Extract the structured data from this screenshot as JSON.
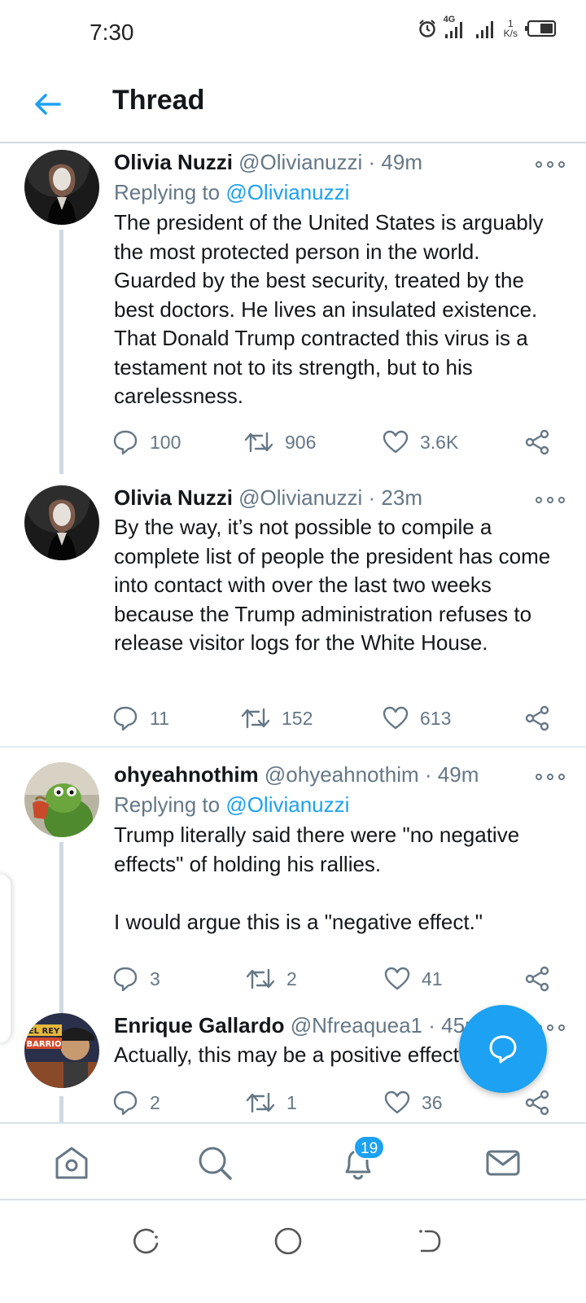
{
  "status_bar": {
    "time": "7:30",
    "network_type": "4G",
    "speed_value": "1",
    "speed_unit": "K/s"
  },
  "header": {
    "title": "Thread",
    "back_icon": "arrow-left-icon"
  },
  "tweets": [
    {
      "name": "Olivia Nuzzi",
      "handle": "@Olivianuzzi",
      "dot": "·",
      "time": "49m",
      "replying_label": "Replying to",
      "replying_to": "@Olivianuzzi",
      "text": "The president of the United States is arguably the most protected person in the world. Guarded by the best security, treated by the best doctors. He lives an insulated existence. That Donald Trump contracted this virus is a testament not to its strength, but to his carelessness.",
      "replies": "100",
      "retweets": "906",
      "likes": "3.6K"
    },
    {
      "name": "Olivia Nuzzi",
      "handle": "@Olivianuzzi",
      "dot": "·",
      "time": "23m",
      "text": "By the way, it’s not possible to compile a complete list of people the president has come into contact with over the last two weeks because the Trump administration refuses to release visitor logs for the White House.",
      "replies": "11",
      "retweets": "152",
      "likes": "613"
    },
    {
      "name": "ohyeahnothim",
      "handle": "@ohyeahnothim",
      "dot": "·",
      "time": "49m",
      "replying_label": "Replying to",
      "replying_to": "@Olivianuzzi",
      "text": "Trump literally said there were \"no negative effects\" of holding his rallies.\n\nI would argue this is a \"negative effect.\"",
      "replies": "3",
      "retweets": "2",
      "likes": "41"
    },
    {
      "name": "Enrique Gallardo",
      "handle": "@Nfreaquea1",
      "dot": "·",
      "time": "45m",
      "text": "Actually, this may be a positive effect",
      "avatar_text": "EL REY BARRIO",
      "replies": "2",
      "retweets": "1",
      "likes": "36"
    }
  ],
  "fab": {
    "icon": "compose-reply-icon"
  },
  "tabbar": {
    "items": [
      "home-icon",
      "search-icon",
      "notifications-icon",
      "messages-icon"
    ],
    "notifications_badge": "19"
  },
  "colors": {
    "accent": "#1da1f2",
    "text": "#14171a",
    "secondary": "#657786",
    "thread_line": "#cfd9e1"
  }
}
